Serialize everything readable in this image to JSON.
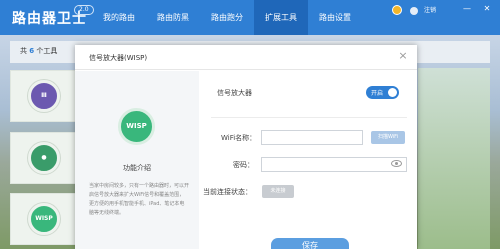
{
  "app": {
    "name": "路由器卫士",
    "version": "2.0",
    "logout_label": "注销"
  },
  "nav": {
    "items": [
      {
        "label": "我的路由"
      },
      {
        "label": "路由防黑"
      },
      {
        "label": "路由跑分"
      },
      {
        "label": "扩展工具",
        "active": true
      },
      {
        "label": "路由设置"
      }
    ]
  },
  "window_controls": {
    "minimize": "—",
    "close": "✕"
  },
  "toolbar": {
    "count_prefix": "共",
    "count_value": "6",
    "count_suffix": "个工具"
  },
  "tools": [
    {
      "icon": "purple-tool-icon",
      "glyph": "Ⅲ",
      "color": "#6c59b0"
    },
    {
      "icon": "user-tool-icon",
      "glyph": "●",
      "color": "#3a9c6a"
    },
    {
      "icon": "wisp-tool-icon",
      "glyph": "WISP",
      "color": "#39b77c"
    }
  ],
  "modal": {
    "title": "信号放大器(WISP)",
    "close": "×",
    "logo_text": "WISP",
    "intro_title": "功能介绍",
    "intro_text": "当家中房间较多，只有一个路由器时，可以开启信号放大器来扩大WiFi信号和覆盖范围，更方便的用手机智能手机、iPad、笔记本电脑等无线终端。",
    "fields": {
      "amp_label": "信号放大器",
      "toggle_label": "开启",
      "toggle_on": true,
      "ssid_label": "WiFi名称：",
      "ssid_value": "",
      "scan_button": "扫描WiFi",
      "password_label": "密码：",
      "password_value": "",
      "status_label": "当前连接状态：",
      "status_value": "未连接"
    },
    "save_button": "保存"
  },
  "colors": {
    "brand_blue": "#2f7fd4",
    "wisp_green": "#39b77c"
  }
}
